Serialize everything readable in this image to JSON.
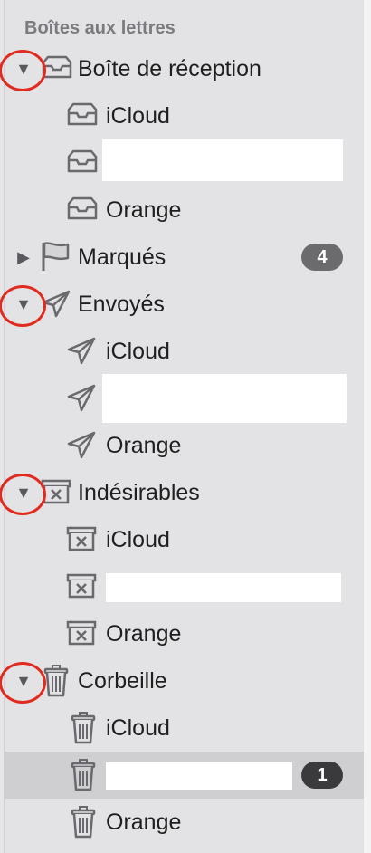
{
  "sidebar": {
    "section_title": "Boîtes aux lettres",
    "inbox": {
      "label": "Boîte de réception",
      "children": [
        {
          "label": "iCloud"
        },
        {
          "label": ""
        },
        {
          "label": "Orange"
        }
      ]
    },
    "flagged": {
      "label": "Marqués",
      "count": "4"
    },
    "sent": {
      "label": "Envoyés",
      "children": [
        {
          "label": "iCloud"
        },
        {
          "label": ""
        },
        {
          "label": "Orange"
        }
      ]
    },
    "junk": {
      "label": "Indésirables",
      "children": [
        {
          "label": "iCloud"
        },
        {
          "label": ""
        },
        {
          "label": "Orange"
        }
      ]
    },
    "trash": {
      "label": "Corbeille",
      "children": [
        {
          "label": "iCloud"
        },
        {
          "label": "",
          "count": "1",
          "selected": true
        },
        {
          "label": "Orange"
        }
      ]
    }
  },
  "colors": {
    "annotation_circle": "#e02b20",
    "selected_row": "#cfcfd2",
    "badge": "#6b6b6e"
  },
  "icons": {
    "disclosure_open": "triangle-down",
    "disclosure_closed": "triangle-right",
    "inbox": "inbox-tray-icon",
    "flag": "flag-icon",
    "sent": "paper-plane-icon",
    "junk": "junk-box-icon",
    "trash": "trash-can-icon"
  }
}
